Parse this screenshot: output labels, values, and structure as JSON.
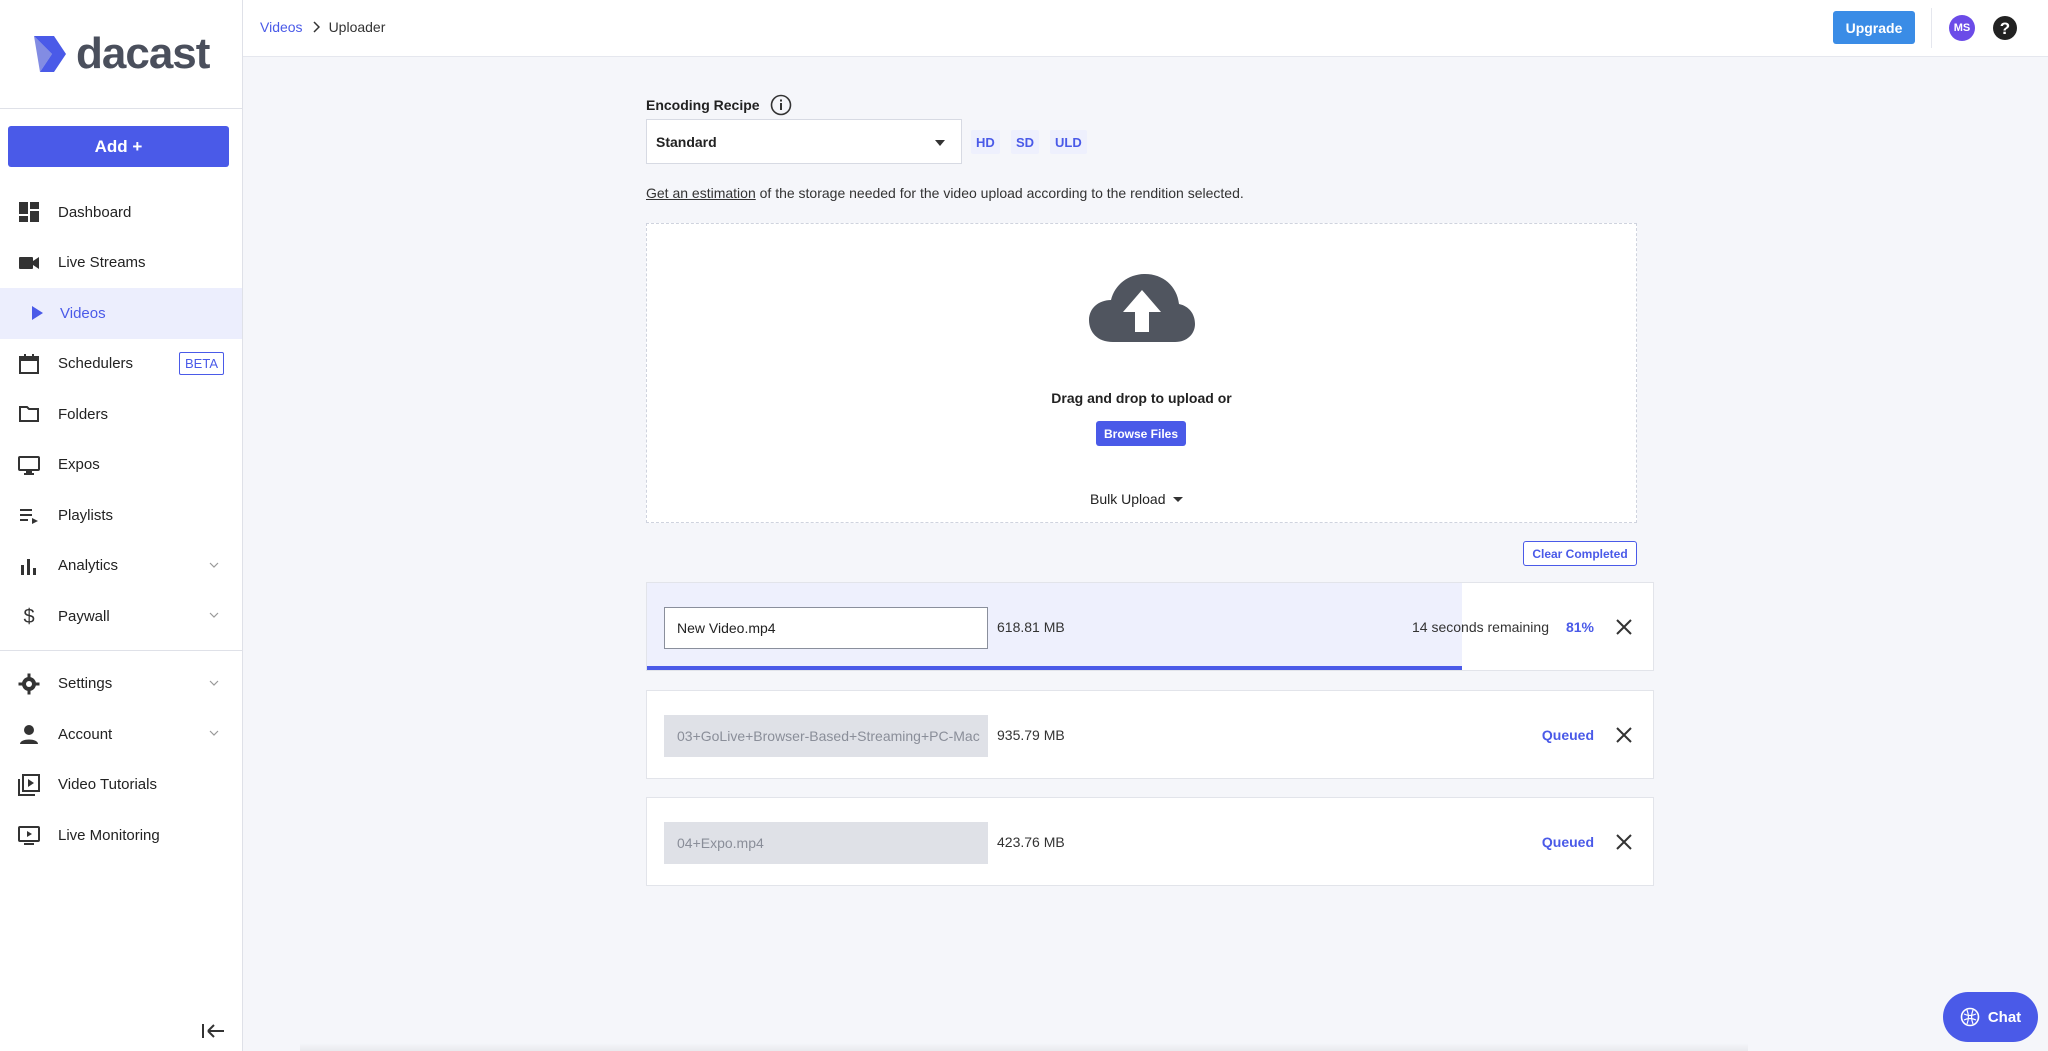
{
  "brand": {
    "name": "dacast"
  },
  "sidebar": {
    "add_label": "Add +",
    "items": [
      {
        "label": "Dashboard",
        "icon": "dashboard-icon"
      },
      {
        "label": "Live Streams",
        "icon": "video-camera-icon"
      },
      {
        "label": "Videos",
        "icon": "play-icon",
        "active": true
      },
      {
        "label": "Schedulers",
        "icon": "calendar-icon",
        "badge": "BETA"
      },
      {
        "label": "Folders",
        "icon": "folder-icon"
      },
      {
        "label": "Expos",
        "icon": "monitor-icon"
      },
      {
        "label": "Playlists",
        "icon": "playlist-icon"
      },
      {
        "label": "Analytics",
        "icon": "bar-chart-icon",
        "expandable": true
      },
      {
        "label": "Paywall",
        "icon": "dollar-icon",
        "expandable": true
      },
      {
        "label": "Settings",
        "icon": "gear-icon",
        "expandable": true
      },
      {
        "label": "Account",
        "icon": "person-icon",
        "expandable": true
      },
      {
        "label": "Video Tutorials",
        "icon": "video-library-icon"
      },
      {
        "label": "Live Monitoring",
        "icon": "live-monitor-icon"
      }
    ]
  },
  "header": {
    "breadcrumb": {
      "parent": "Videos",
      "current": "Uploader"
    },
    "upgrade_label": "Upgrade",
    "avatar_initials": "MS"
  },
  "encoding": {
    "label": "Encoding Recipe",
    "selected": "Standard",
    "renditions": [
      "HD",
      "SD",
      "ULD"
    ],
    "estimation_link": "Get an estimation",
    "estimation_text": " of the storage needed for the video upload according to the rendition selected."
  },
  "dropzone": {
    "drag_text": "Drag and drop to upload or",
    "browse_label": "Browse Files",
    "bulk_label": "Bulk Upload"
  },
  "uploads": {
    "clear_label": "Clear Completed",
    "items": [
      {
        "name": "New Video.mp4",
        "size": "618.81 MB",
        "remaining": "14 seconds remaining",
        "percent": "81%",
        "progress": 0.81
      },
      {
        "name": "03+GoLive+Browser-Based+Streaming+PC-Mac",
        "size": "935.79 MB",
        "status": "Queued"
      },
      {
        "name": "04+Expo.mp4",
        "size": "423.76 MB",
        "status": "Queued"
      }
    ]
  },
  "chat": {
    "label": "Chat"
  },
  "colors": {
    "accent": "#4a5ae8",
    "upgrade": "#3a8ce6",
    "avatar": "#6b4be8"
  }
}
